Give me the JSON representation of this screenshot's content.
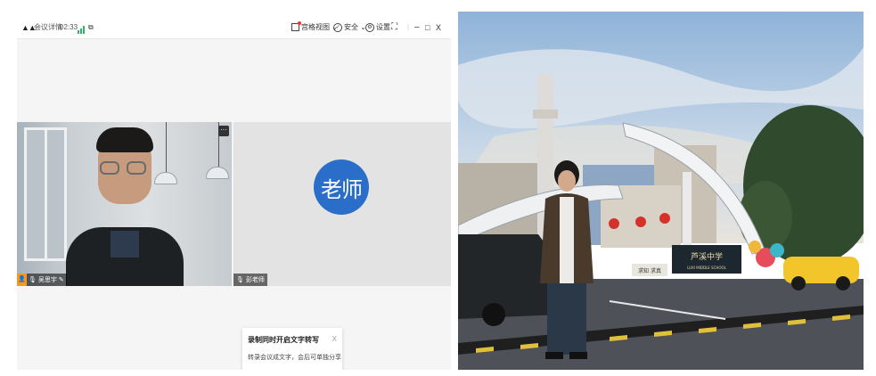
{
  "meeting": {
    "logo": "腾讯会议",
    "info_label": "会议详情",
    "timer": "02:33",
    "view_label": "宫格视图",
    "security_label": "安全",
    "settings_label": "设置",
    "window_controls": {
      "minimize": "–",
      "maximize": "□",
      "close": "X"
    },
    "colors": {
      "signal": "#2fb46c",
      "avatar": "#2a6ec9",
      "host_badge": "#f39a1e"
    }
  },
  "participants": [
    {
      "name": "吴思宇",
      "video": true,
      "host": true
    },
    {
      "name": "彭老师",
      "video": false,
      "avatar_text": "老师"
    }
  ],
  "tip": {
    "title": "录制同时开启文字转写",
    "body": "转录会议成文字，会后可单独分享",
    "close": "X"
  },
  "photo": {
    "gate_sign": "芦溪中学",
    "gate_sign_en": "LUXI MIDDLE SCHOOL",
    "building_sign": "芦溪中学",
    "banner": "求知 求真"
  }
}
